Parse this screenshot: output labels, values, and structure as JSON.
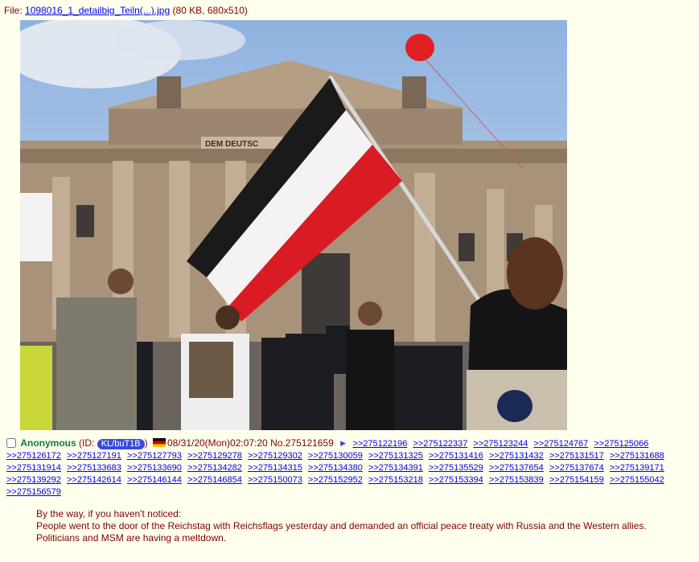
{
  "file": {
    "prefix": "File: ",
    "name": "1098016_1_detailbig_Teiln(...).jpg",
    "meta": " (80 KB, 680x510)"
  },
  "image": {
    "pediment_text": "DEM DEUTSC"
  },
  "post": {
    "name": "Anonymous",
    "id_prefix": "(ID: ",
    "id": "KL/buT1B",
    "id_suffix": ")",
    "country_flag": "germany-flag",
    "datetime": "08/31/20(Mon)02:07:20",
    "number": "No.275121659",
    "backlinks": [
      ">>275122196",
      ">>275122337",
      ">>275123244",
      ">>275124767",
      ">>275125066",
      ">>275126172",
      ">>275127191",
      ">>275127793",
      ">>275129278",
      ">>275129302",
      ">>275130059",
      ">>275131325",
      ">>275131416",
      ">>275131432",
      ">>275131517",
      ">>275131688",
      ">>275131914",
      ">>275133683",
      ">>275133690",
      ">>275134282",
      ">>275134315",
      ">>275134380",
      ">>275134391",
      ">>275135529",
      ">>275137654",
      ">>275137674",
      ">>275139171",
      ">>275139292",
      ">>275142614",
      ">>275146144",
      ">>275146854",
      ">>275150073",
      ">>275152952",
      ">>275153218",
      ">>275153394",
      ">>275153839",
      ">>275154159",
      ">>275155042",
      ">>275156579"
    ],
    "body": [
      "By the way, if you haven't noticed:",
      "People went to the door of the Reichstag with Reichsflags yesterday and demanded an official peace treaty with Russia and the Western allies.",
      "Politicians and MSM are having a meltdown."
    ]
  },
  "colors": {
    "background": "#ffffee",
    "name": "#117743",
    "text": "#800000",
    "link": "#0000ee",
    "id_badge": "#3a4bd8"
  }
}
